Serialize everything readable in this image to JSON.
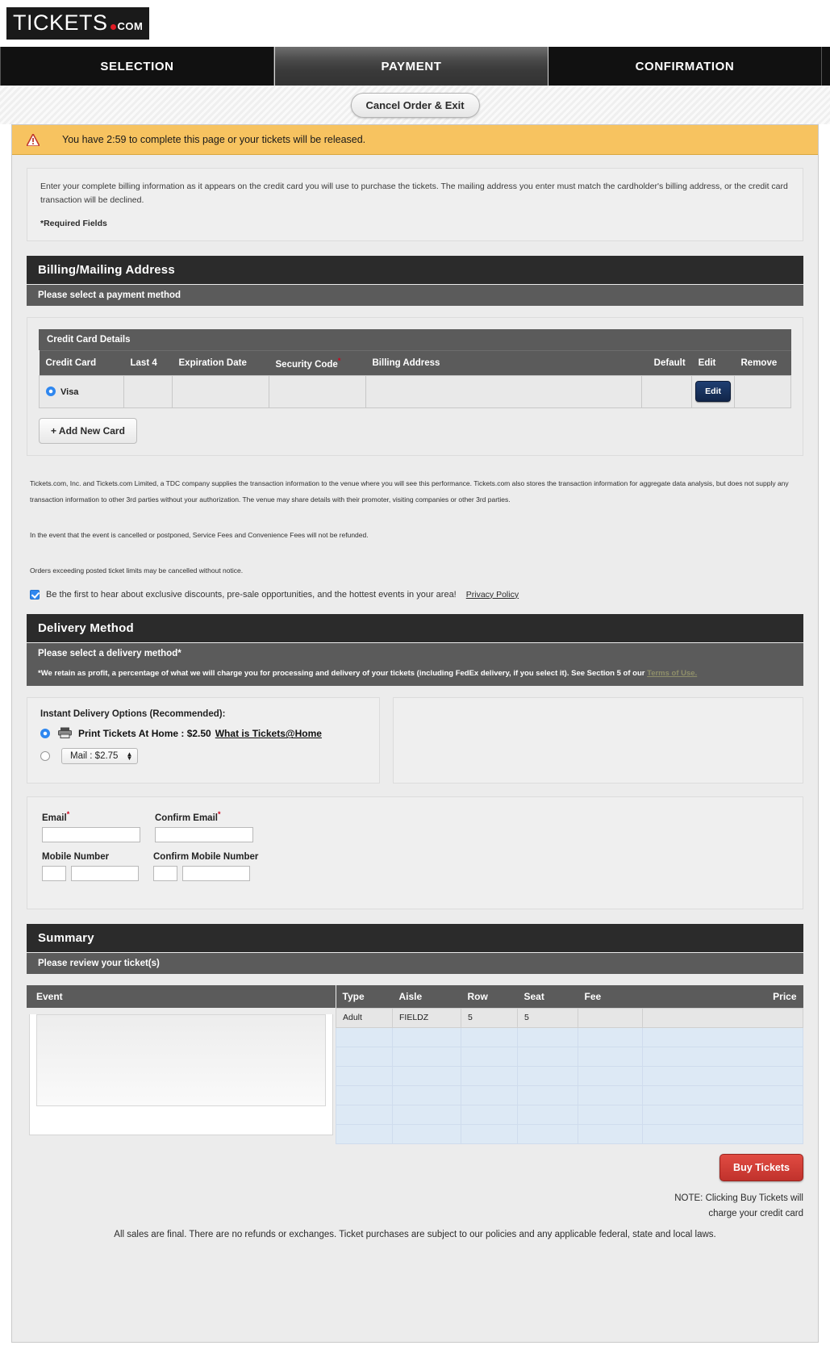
{
  "brand": {
    "name": "TICKETS",
    "suffix": "COM"
  },
  "steps": [
    {
      "label": "SELECTION",
      "active": false
    },
    {
      "label": "PAYMENT",
      "active": true
    },
    {
      "label": "CONFIRMATION",
      "active": false
    }
  ],
  "cancel_button": "Cancel Order & Exit",
  "alert": {
    "icon": "warning-triangle-icon",
    "text": "You have 2:59 to complete this page or your tickets will be released.",
    "timer": "2:59",
    "bg_color": "#f7c360"
  },
  "intro": {
    "paragraph": "Enter your complete billing information as it appears on the credit card you will use to purchase the tickets. The mailing address you enter must match the cardholder's billing address, or the credit card transaction will be declined.",
    "required_fields": "*Required Fields"
  },
  "billing": {
    "title": "Billing/Mailing Address",
    "subtitle": "Please select a payment method",
    "card_details_header": "Credit Card Details",
    "columns": [
      "Credit Card",
      "Last 4",
      "Expiration Date",
      "Security Code",
      "Billing Address",
      "Default",
      "Edit",
      "Remove"
    ],
    "security_code_required_marker": "*",
    "rows": [
      {
        "selected": true,
        "card": "Visa",
        "last4": "",
        "expiration": "",
        "security_code": "",
        "billing_address": "",
        "default": "",
        "edit_label": "Edit",
        "remove": ""
      }
    ],
    "add_card_label": "+ Add New Card"
  },
  "legal": {
    "paragraph1": "Tickets.com, Inc. and Tickets.com Limited, a TDC company supplies the transaction information to the venue where you will see this performance. Tickets.com also stores the transaction information for aggregate data analysis, but does not supply any transaction information to other 3rd parties without your authorization. The venue may share details with their promoter, visiting companies or other 3rd parties.",
    "paragraph2": "In the event that the event is cancelled or postponed, Service Fees and Convenience Fees will not be refunded.",
    "paragraph3": "Orders exceeding posted ticket limits may be cancelled without notice.",
    "optin_checked": true,
    "optin_text": "Be the first to hear about exclusive discounts, pre-sale opportunities, and the hottest events in your area!",
    "privacy_policy": "Privacy Policy"
  },
  "delivery": {
    "title": "Delivery Method",
    "subtitle": "Please select a delivery method*",
    "note": "*We retain as profit, a percentage of what we will charge you for processing and delivery of your tickets (including FedEx delivery, if you select it). See Section 5 of our",
    "note_link": "Terms of Use.",
    "instant_label": "Instant Delivery Options (Recommended):",
    "options": [
      {
        "selected": true,
        "icon": "printer-icon",
        "label": "Print Tickets At Home : $2.50",
        "link": "What is Tickets@Home",
        "price": "$2.50"
      },
      {
        "selected": false,
        "icon": "",
        "label": "Mail : $2.75",
        "link": "",
        "price": "$2.75",
        "is_select": true
      }
    ]
  },
  "contact": {
    "email_label": "Email",
    "email_value": "",
    "confirm_email_label": "Confirm Email",
    "confirm_email_value": "",
    "mobile_label": "Mobile Number",
    "mobile_prefix": "",
    "mobile_value": "",
    "confirm_mobile_label": "Confirm Mobile Number",
    "confirm_mobile_prefix": "",
    "confirm_mobile_value": "",
    "required_marker": "*"
  },
  "summary": {
    "title": "Summary",
    "subtitle": "Please review your ticket(s)",
    "event_column": "Event",
    "columns": [
      "Type",
      "Aisle",
      "Row",
      "Seat",
      "Fee",
      "Price"
    ],
    "rows": [
      {
        "type": "Adult",
        "aisle": "FIELDZ",
        "row": "5",
        "seat": "5",
        "fee": "",
        "price": ""
      }
    ],
    "blank_row_count": 6
  },
  "footer": {
    "buy_label": "Buy Tickets",
    "note_line1": "NOTE: Clicking Buy Tickets will",
    "note_line2": "charge your credit card",
    "terms": "All sales are final. There are no refunds or exchanges. Ticket purchases are subject to our policies and any applicable federal, state and local laws."
  }
}
